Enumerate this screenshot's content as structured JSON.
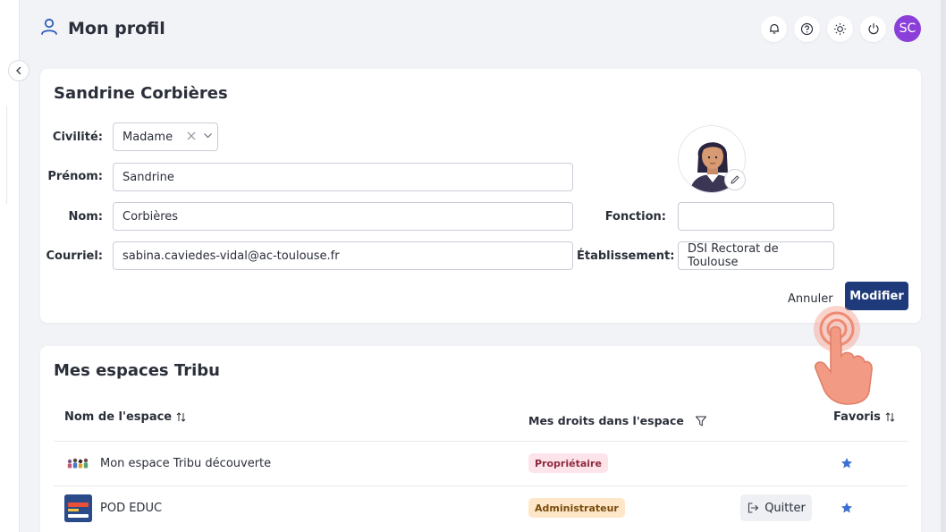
{
  "header": {
    "title": "Mon profil",
    "avatar_initials": "SC",
    "icons": [
      "bell-icon",
      "help-icon",
      "sun-icon",
      "power-icon"
    ]
  },
  "profile": {
    "name": "Sandrine Corbières",
    "civilite_label": "Civilité:",
    "civilite_value": "Madame",
    "prenom_label": "Prénom:",
    "prenom_value": "Sandrine",
    "nom_label": "Nom:",
    "nom_value": "Corbières",
    "courriel_label": "Courriel:",
    "courriel_value": "sabina.caviedes-vidal@ac-toulouse.fr",
    "fonction_label": "Fonction:",
    "fonction_value": "",
    "etablissement_label": "Établissement:",
    "etablissement_value": "DSI Rectorat de Toulouse",
    "cancel_label": "Annuler",
    "modify_label": "Modifier"
  },
  "spaces": {
    "title": "Mes espaces Tribu",
    "col_name": "Nom de l'espace",
    "col_rights": "Mes droits dans l'espace",
    "col_favorites": "Favoris",
    "rows": [
      {
        "name": "Mon espace Tribu découverte",
        "right": "Propriétaire",
        "favorite": true
      },
      {
        "name": "POD EDUC",
        "right": "Administrateur",
        "favorite": true,
        "action": "Quitter"
      }
    ]
  },
  "colors": {
    "accent": "#1f3a7a",
    "avatar": "#8b3fd9",
    "owner_badge": "#fde4ea",
    "admin_badge": "#fde7c8",
    "star": "#3b6fd1"
  }
}
